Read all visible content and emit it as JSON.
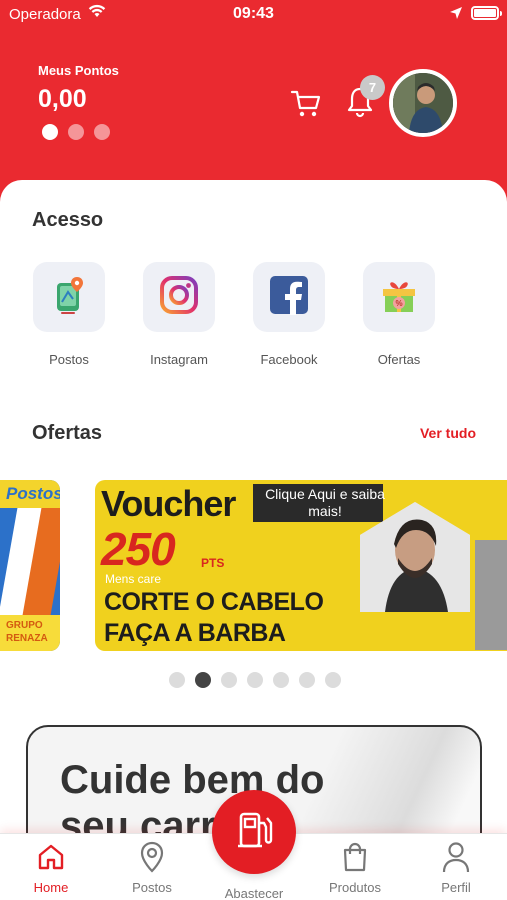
{
  "status_bar": {
    "carrier": "Operadora",
    "time": "09:43"
  },
  "header": {
    "points_label": "Meus Pontos",
    "points_value": "0,00",
    "notification_count": "7",
    "pager_dots": 3,
    "pager_active": 0
  },
  "access": {
    "title": "Acesso",
    "items": [
      {
        "label": "Postos",
        "icon": "map-pin-icon"
      },
      {
        "label": "Instagram",
        "icon": "instagram-icon"
      },
      {
        "label": "Facebook",
        "icon": "facebook-icon"
      },
      {
        "label": "Ofertas",
        "icon": "gift-icon"
      }
    ]
  },
  "offers": {
    "title": "Ofertas",
    "see_all": "Ver tudo",
    "left_banner": {
      "top": "Postos",
      "bottom": "GRUPO RENAZA"
    },
    "main_banner": {
      "headline": "Voucher",
      "cta": "Clique Aqui e saiba mais!",
      "points": "250",
      "points_unit": "PTS",
      "brand": "Mens care",
      "line1": "CORTE O CABELO",
      "line2": "FAÇA A BARBA"
    },
    "carousel_dots": 7,
    "carousel_active": 1
  },
  "promo": {
    "text": "Cuide bem do seu carro!"
  },
  "tabbar": {
    "home": "Home",
    "postos": "Postos",
    "abastecer": "Abastecer",
    "produtos": "Produtos",
    "perfil": "Perfil",
    "active_tab": "home"
  },
  "colors": {
    "brand_red": "#ea2a30",
    "link_red": "#e31e24",
    "voucher_yellow": "#f0d11e"
  }
}
